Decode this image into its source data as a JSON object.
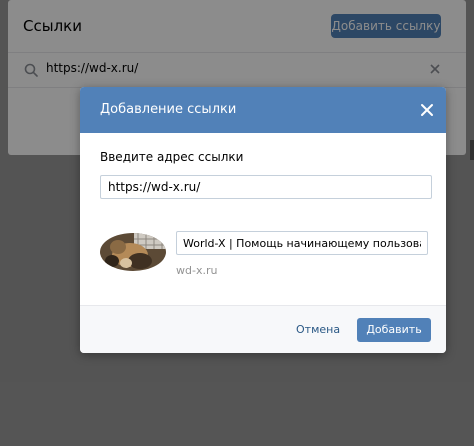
{
  "page": {
    "title": "Ссылки",
    "add_button_label": "Добавить ссылку",
    "search_value": "https://wd-x.ru/"
  },
  "modal": {
    "title": "Добавление ссылки",
    "url_label": "Введите адрес ссылки",
    "url_value": "https://wd-x.ru/",
    "preview": {
      "title_value": "World-X | Помощь начинающему пользователю",
      "domain": "wd-x.ru"
    },
    "cancel_label": "Отмена",
    "submit_label": "Добавить"
  },
  "colors": {
    "accent": "#5181b8",
    "link": "#2a5885"
  },
  "icons": {
    "search": "search-icon",
    "clear": "close-icon",
    "modal_close": "close-icon"
  }
}
